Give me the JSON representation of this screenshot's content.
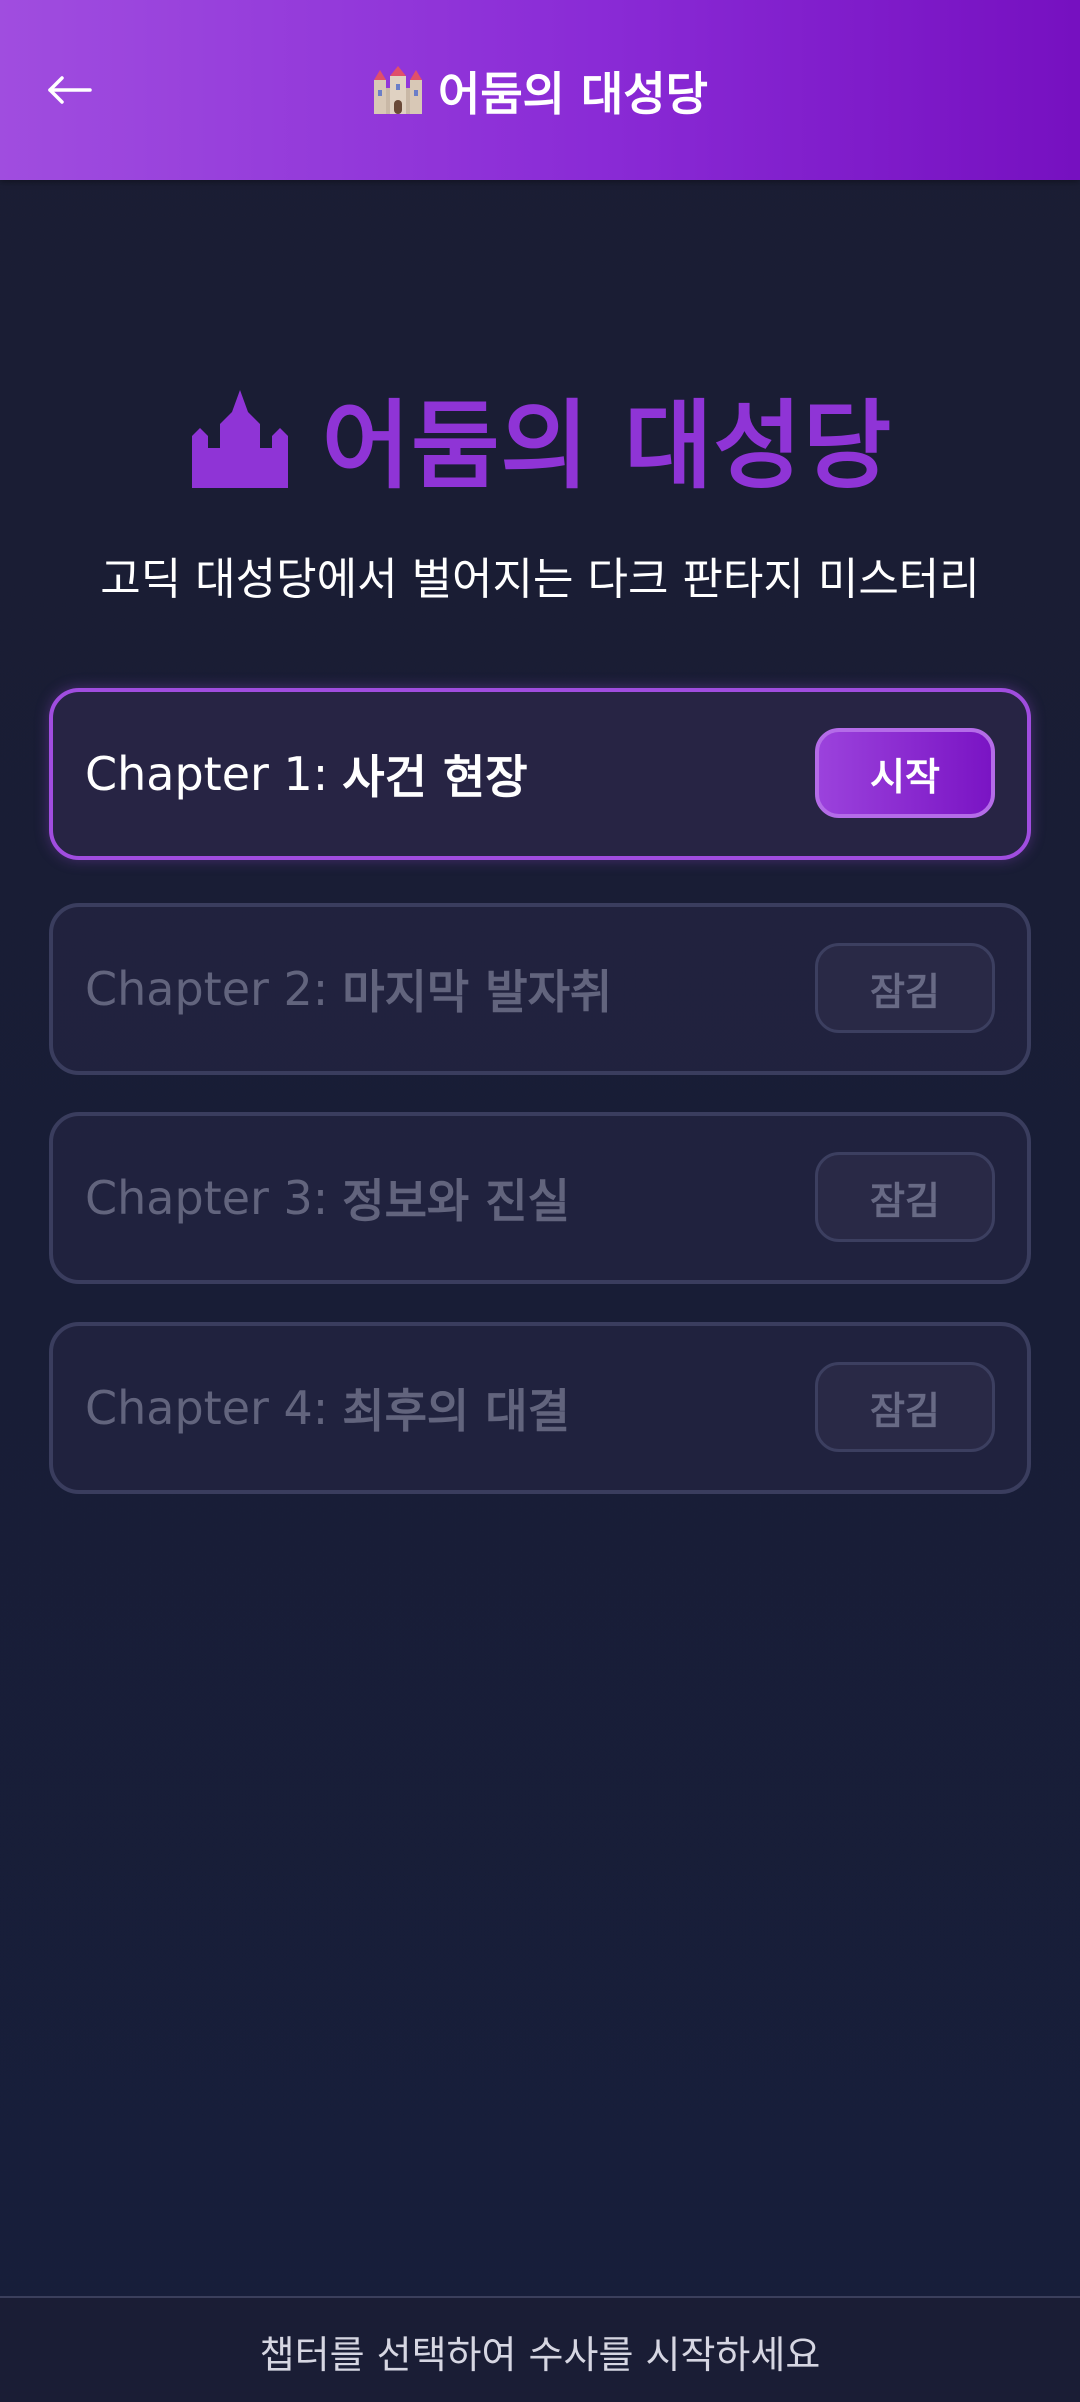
{
  "header": {
    "back_icon": "left-arrow-icon",
    "title_icon": "castle-emoji-icon",
    "title": "어둠의 대성당"
  },
  "hero": {
    "icon": "castle-silhouette-icon",
    "title": "어둠의 대성당",
    "subtitle": "고딕 대성당에서 벌어지는 다크 판타지 미스터리"
  },
  "chapters": [
    {
      "number": "Chapter 1:",
      "name": "사건 현장",
      "button": "시작",
      "state": "active"
    },
    {
      "number": "Chapter 2:",
      "name": "마지막 발자취",
      "button": "잠김",
      "state": "locked"
    },
    {
      "number": "Chapter 3:",
      "name": "정보와 진실",
      "button": "잠김",
      "state": "locked"
    },
    {
      "number": "Chapter 4:",
      "name": "최후의 대결",
      "button": "잠김",
      "state": "locked"
    }
  ],
  "footer": {
    "text": "챕터를 선택하여 수사를 시작하세요"
  },
  "colors": {
    "accent": "#8f34d6",
    "header_start": "#a04ddf",
    "header_end": "#7610c0",
    "background": "#1b1d33"
  }
}
